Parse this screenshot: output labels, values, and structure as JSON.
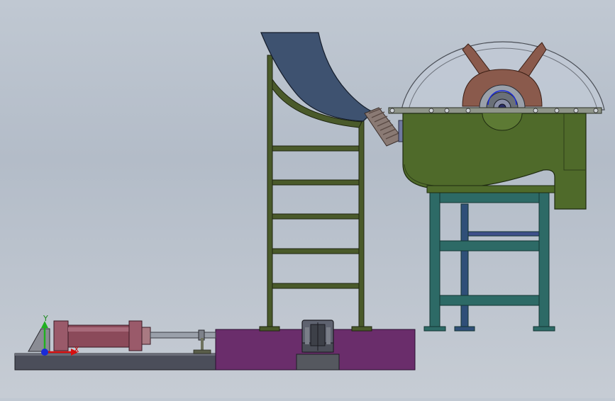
{
  "triad": {
    "y_label": "Y",
    "x_label": "X",
    "colors": {
      "x": "#d81010",
      "y": "#20b020",
      "z": "#1a2ad8"
    }
  },
  "colors": {
    "base_plate": "#4b4e5a",
    "platform": "#6a2d6b",
    "cylinder": "#8b4a5a",
    "ladder_frame": "#4a5a2a",
    "chute": "#3e5270",
    "hopper": "#4f6a2a",
    "stand": "#2d6a66",
    "cover": "#c2cad6",
    "rotor": "#8a5a4c"
  }
}
